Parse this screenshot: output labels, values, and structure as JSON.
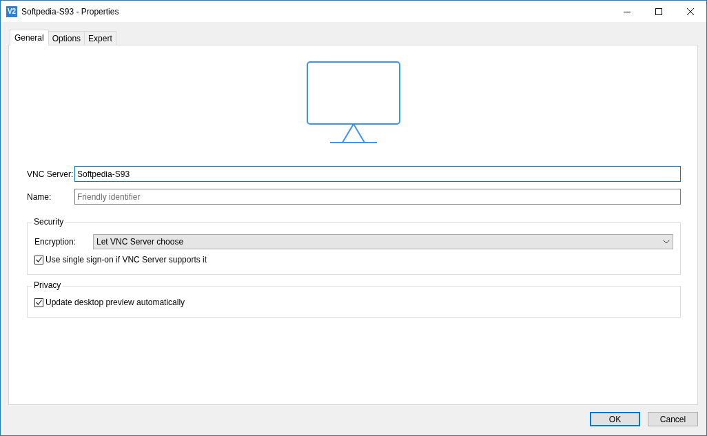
{
  "window": {
    "logo": "V2",
    "title": "Softpedia-S93 - Properties"
  },
  "tabs": [
    {
      "label": "General",
      "selected": true
    },
    {
      "label": "Options",
      "selected": false
    },
    {
      "label": "Expert",
      "selected": false
    }
  ],
  "fields": [
    {
      "label": "VNC Server:",
      "value": "Softpedia-S93",
      "focused": true
    },
    {
      "label": "Name:",
      "placeholder": "Friendly identifier",
      "focused": false
    }
  ],
  "groups": [
    {
      "title": "Security",
      "rows": [
        {
          "kind": "dropdown",
          "label": "Encryption:",
          "value": "Let VNC Server choose"
        },
        {
          "kind": "checkbox",
          "label": "Use single sign-on if VNC Server supports it",
          "checked": true
        }
      ]
    },
    {
      "title": "Privacy",
      "rows": [
        {
          "kind": "checkbox",
          "label": "Update desktop preview automatically",
          "checked": true
        }
      ]
    }
  ],
  "buttons": [
    {
      "label": "OK",
      "default": true
    },
    {
      "label": "Cancel",
      "default": false
    }
  ]
}
